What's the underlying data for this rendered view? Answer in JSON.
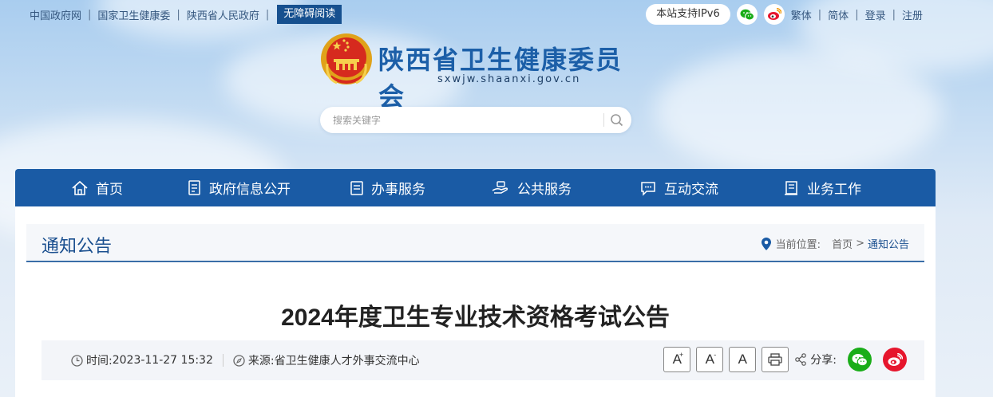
{
  "top_links": [
    "中国政府网",
    "国家卫生健康委",
    "陕西省人民政府"
  ],
  "accessibility_label": "无障碍阅读",
  "ipv6_label": "本站支持IPv6",
  "top_right_links": [
    "繁体",
    "简体",
    "登录",
    "注册"
  ],
  "site": {
    "title": "陕西省卫生健康委员会",
    "url": "sxwjw.shaanxi.gov.cn"
  },
  "search": {
    "placeholder": "搜索关键字"
  },
  "nav": [
    "首页",
    "政府信息公开",
    "办事服务",
    "公共服务",
    "互动交流",
    "业务工作"
  ],
  "section_heading": "通知公告",
  "breadcrumb": {
    "label": "当前位置:",
    "home": "首页",
    "arrow": ">",
    "current": "通知公告"
  },
  "article": {
    "title": "2024年度卫生专业技术资格考试公告",
    "time_label": "时间:",
    "time_value": "2023-11-27 15:32",
    "source_label": "来源:",
    "source_value": "省卫生健康人才外事交流中心"
  },
  "font_buttons": {
    "large": "A",
    "medium": "A",
    "small": "A"
  },
  "share_label": "分享:",
  "colors": {
    "nav_bg": "#1a5ba5",
    "access_bg": "#16508f",
    "wechat": "#1aad19",
    "weibo": "#e6162d"
  }
}
